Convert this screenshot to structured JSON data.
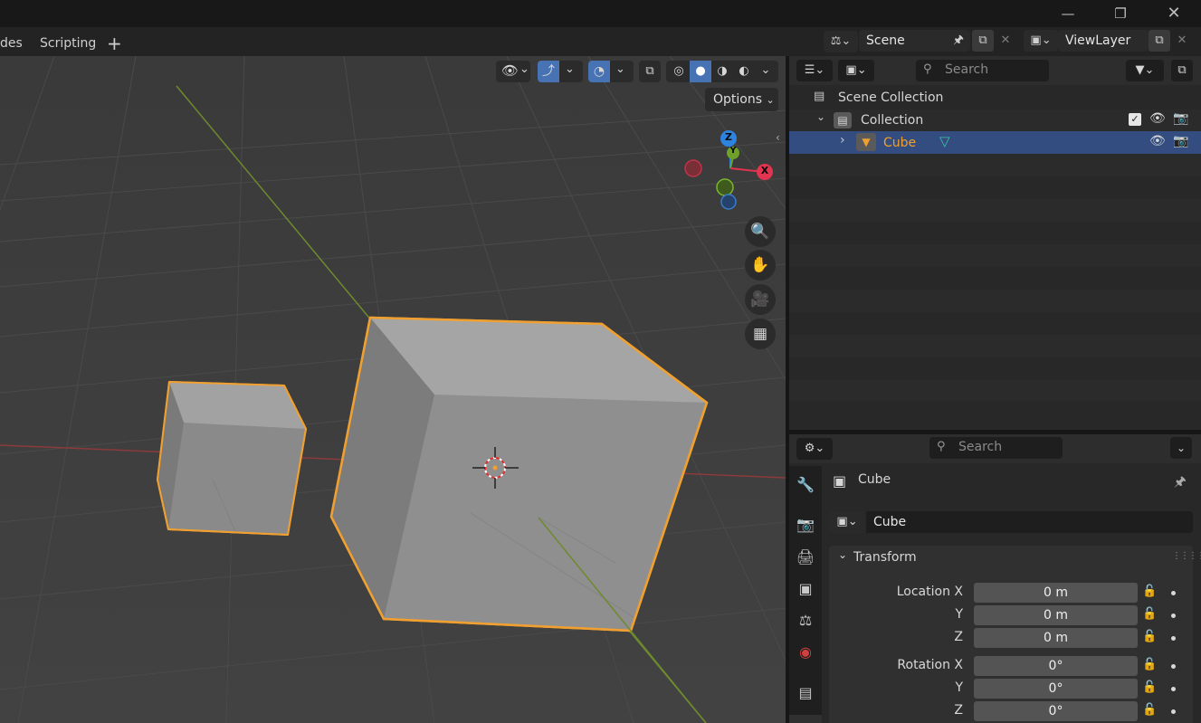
{
  "workspace": {
    "tabs": [
      {
        "label": "des"
      },
      {
        "label": "Scripting"
      }
    ],
    "add_label": "+"
  },
  "scene": {
    "name": "Scene"
  },
  "view_layer": {
    "name": "ViewLayer"
  },
  "viewport": {
    "options_label": "Options",
    "gizmo": {
      "z": "Z",
      "y": "Y",
      "x": "X"
    }
  },
  "outliner": {
    "search_placeholder": "Search",
    "rows": [
      {
        "label": "Scene Collection"
      },
      {
        "label": "Collection"
      },
      {
        "label": "Cube"
      }
    ]
  },
  "properties": {
    "search_placeholder": "Search",
    "object_title": "Cube",
    "object_name_value": "Cube",
    "panel_title": "Transform",
    "fields": [
      {
        "label": "Location X",
        "value": "0 m"
      },
      {
        "label": "Y",
        "value": "0 m"
      },
      {
        "label": "Z",
        "value": "0 m"
      },
      {
        "label": "Rotation X",
        "value": "0°"
      },
      {
        "label": "Y",
        "value": "0°"
      },
      {
        "label": "Z",
        "value": "0°"
      }
    ]
  },
  "colors": {
    "selection_outline": "#f0a030",
    "active_row": "#334d80",
    "axis_x": "#e0344f",
    "axis_y": "#6ea02a",
    "axis_z": "#2f83e0"
  }
}
